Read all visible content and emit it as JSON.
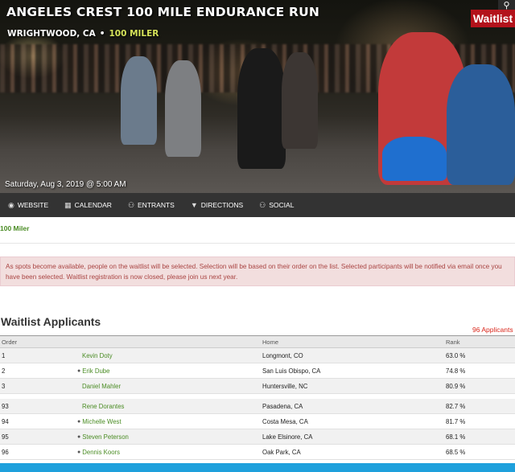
{
  "hero": {
    "title": "ANGELES CREST 100 MILE ENDURANCE RUN",
    "location": "WRIGHTWOOD, CA",
    "separator": "•",
    "distance": "100 MILER",
    "date": "Saturday, Aug 3, 2019 @ 5:00 AM",
    "badge": "Waitlist",
    "search_icon": "search-icon"
  },
  "nav": {
    "items": [
      {
        "label": "WEBSITE",
        "icon": "globe-icon",
        "glyph": "◉"
      },
      {
        "label": "CALENDAR",
        "icon": "calendar-icon",
        "glyph": "▦"
      },
      {
        "label": "ENTRANTS",
        "icon": "people-icon",
        "glyph": "⚇"
      },
      {
        "label": "DIRECTIONS",
        "icon": "map-pin-icon",
        "glyph": "▼"
      },
      {
        "label": "SOCIAL",
        "icon": "social-icon",
        "glyph": "⚇"
      }
    ]
  },
  "race_link": "100 Miler",
  "notice": "As spots become available, people on the waitlist will be selected. Selection will be based on their order on the list. Selected participants will be notified via email once you have been selected. Waitlist registration is now closed, please join us next year.",
  "waitlist": {
    "title": "Waitlist Applicants",
    "count": "96 Applicants",
    "columns": {
      "order": "Order",
      "name": "",
      "home": "Home",
      "rank": "Rank"
    },
    "rows_top": [
      {
        "order": "1",
        "name": "Kevin Doty",
        "home": "Longmont, CO",
        "rank": "63.0 %",
        "user": false
      },
      {
        "order": "2",
        "name": "Erik Dube",
        "home": "San Luis Obispo, CA",
        "rank": "74.8 %",
        "user": true
      },
      {
        "order": "3",
        "name": "Daniel Mahler",
        "home": "Huntersville, NC",
        "rank": "80.9 %",
        "user": false
      }
    ],
    "rows_bottom": [
      {
        "order": "93",
        "name": "Rene Dorantes",
        "home": "Pasadena, CA",
        "rank": "82.7 %",
        "user": false
      },
      {
        "order": "94",
        "name": "Michelle West",
        "home": "Costa Mesa, CA",
        "rank": "81.7 %",
        "user": true
      },
      {
        "order": "95",
        "name": "Steven Peterson",
        "home": "Lake Elsinore, CA",
        "rank": "68.1 %",
        "user": true
      },
      {
        "order": "96",
        "name": "Dennis Koors",
        "home": "Oak Park, CA",
        "rank": "68.5 %",
        "user": true
      }
    ]
  },
  "colors": {
    "accent_green": "#4a8c24",
    "badge_red": "#b3121b",
    "nav_bg": "#333333",
    "count_red": "#d9251a",
    "bottom_bar": "#1ea0dc"
  }
}
